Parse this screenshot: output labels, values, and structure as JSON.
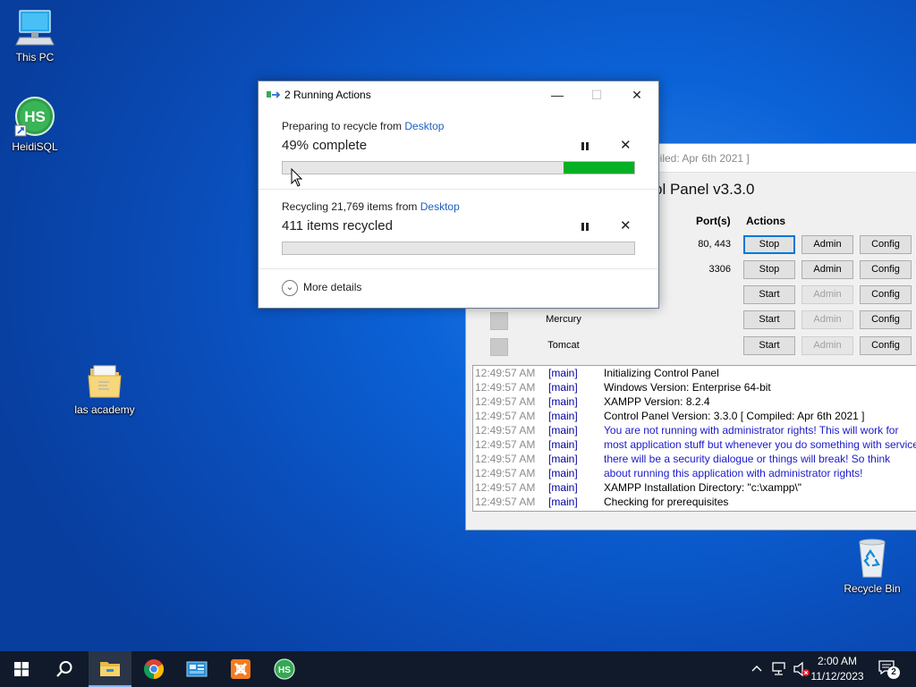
{
  "desktop": {
    "icons": {
      "this_pc": "This PC",
      "heidisql": "HeidiSQL",
      "folder": "las academy",
      "recycle_bin": "Recycle Bin"
    }
  },
  "xampp": {
    "title_partial": "piled: Apr 6th 2021 ]",
    "panel_title_partial": "ol Panel v3.3.0",
    "headers": {
      "ports": "Port(s)",
      "actions": "Actions"
    },
    "rows": [
      {
        "name": "",
        "ports": "80, 443",
        "btn1": "Stop",
        "btn2": "Admin",
        "btn3": "Config"
      },
      {
        "name": "",
        "ports": "3306",
        "btn1": "Stop",
        "btn2": "Admin",
        "btn3": "Config"
      },
      {
        "name": "",
        "ports": "",
        "btn1": "Start",
        "btn2": "Admin",
        "btn3": "Config"
      },
      {
        "name": "Mercury",
        "ports": "",
        "btn1": "Start",
        "btn2": "Admin",
        "btn3": "Config"
      },
      {
        "name": "Tomcat",
        "ports": "",
        "btn1": "Start",
        "btn2": "Admin",
        "btn3": "Config"
      }
    ],
    "log": [
      {
        "time": "12:49:57 AM",
        "module": "[main]",
        "msg": "Initializing Control Panel"
      },
      {
        "time": "12:49:57 AM",
        "module": "[main]",
        "msg": "Windows Version:  Enterprise  64-bit"
      },
      {
        "time": "12:49:57 AM",
        "module": "[main]",
        "msg": "XAMPP Version: 8.2.4"
      },
      {
        "time": "12:49:57 AM",
        "module": "[main]",
        "msg": "Control Panel Version: 3.3.0  [ Compiled: Apr 6th 2021 ]"
      },
      {
        "time": "12:49:57 AM",
        "module": "[main]",
        "msg": "You are not running with administrator rights! This will work for"
      },
      {
        "time": "12:49:57 AM",
        "module": "[main]",
        "msg": "most application stuff but whenever you do something with services"
      },
      {
        "time": "12:49:57 AM",
        "module": "[main]",
        "msg": "there will be a security dialogue or things will break! So think"
      },
      {
        "time": "12:49:57 AM",
        "module": "[main]",
        "msg": "about running this application with administrator rights!"
      },
      {
        "time": "12:49:57 AM",
        "module": "[main]",
        "msg": "XAMPP Installation Directory: \"c:\\xampp\\\""
      },
      {
        "time": "12:49:57 AM",
        "module": "[main]",
        "msg": "Checking for prerequisites"
      }
    ]
  },
  "dialog": {
    "title": "2 Running Actions",
    "action1": {
      "prefix": "Preparing to recycle from ",
      "link": "Desktop",
      "status": "49% complete",
      "progress": 0.2
    },
    "action2": {
      "prefix": "Recycling 21,769 items from ",
      "link": "Desktop",
      "status": "411 items recycled",
      "progress": 0
    },
    "more_details": "More details"
  },
  "taskbar": {
    "time": "2:00 AM",
    "date": "11/12/2023",
    "notification_count": "2"
  },
  "colors": {
    "progress_fill": "#06b025",
    "link": "#1f5fbf",
    "log_module": "#0000a0",
    "log_warning": "#1a1acc"
  }
}
